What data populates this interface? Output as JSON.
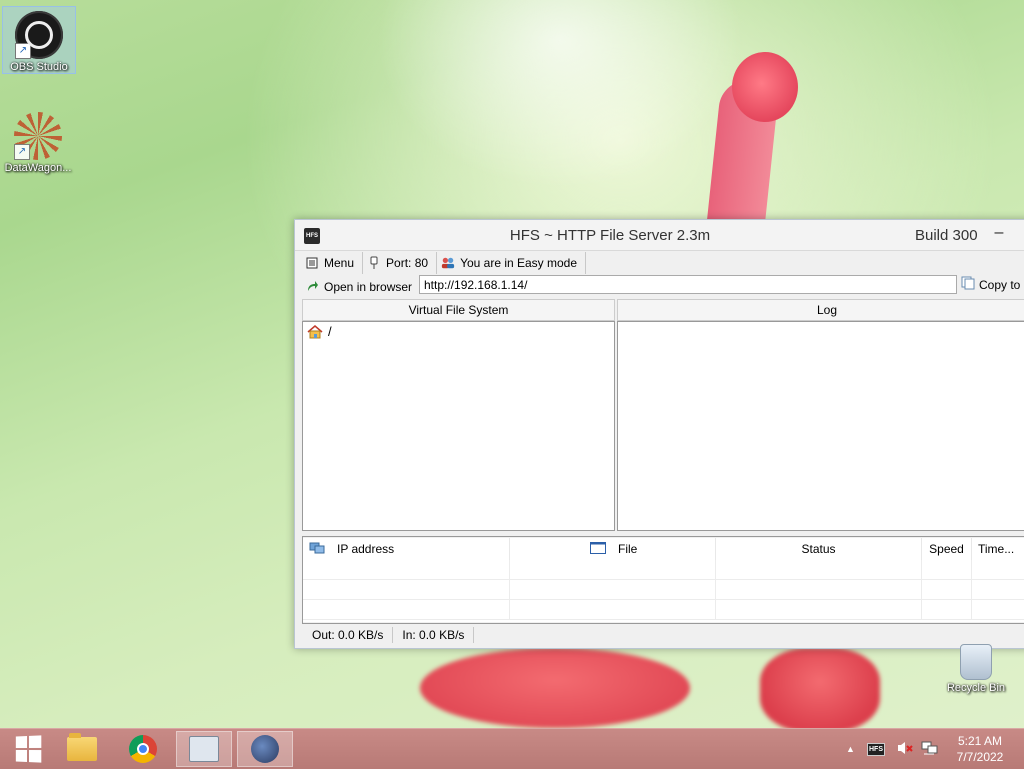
{
  "desktop": {
    "icons": [
      {
        "label": "OBS Studio"
      },
      {
        "label": "DataWagon..."
      }
    ],
    "recycle_bin": "Recycle Bin"
  },
  "window": {
    "title": "HFS ~ HTTP File Server 2.3m",
    "build": "Build 300",
    "minimize_glyph": "–",
    "app_icon_text": "HFS",
    "toolbar": {
      "menu": "Menu",
      "port": "Port: 80",
      "mode": "You are in Easy mode"
    },
    "open_in_browser": "Open in browser",
    "url": "http://192.168.1.14/",
    "copy_to": "Copy to",
    "vfs_header": "Virtual File System",
    "vfs_root": "/",
    "log_header": "Log",
    "connections": {
      "columns": [
        "IP address",
        "File",
        "Status",
        "Speed",
        "Time..."
      ]
    },
    "status": {
      "out": "Out: 0.0 KB/s",
      "in": "In: 0.0 KB/s"
    }
  },
  "taskbar": {
    "clock_time": "5:21 AM",
    "clock_date": "7/7/2022",
    "tray_hfs": "HFS",
    "tray_overflow": "▲"
  },
  "icons": [
    "obs-studio-icon",
    "datawagon-icon",
    "shortcut-arrow-icon",
    "hfs-app-icon",
    "menu-icon",
    "port-icon",
    "users-icon",
    "open-browser-icon",
    "copy-icon",
    "home-folder-icon",
    "network-computer-icon",
    "file-icon",
    "recycle-bin-icon",
    "windows-start-icon",
    "file-explorer-icon",
    "chrome-icon",
    "resource-monitor-icon",
    "hfs-taskbar-icon",
    "speaker-muted-icon",
    "network-icon"
  ],
  "colors": {
    "taskbar": "#b87a76",
    "window_bg": "#f0f0f0"
  }
}
